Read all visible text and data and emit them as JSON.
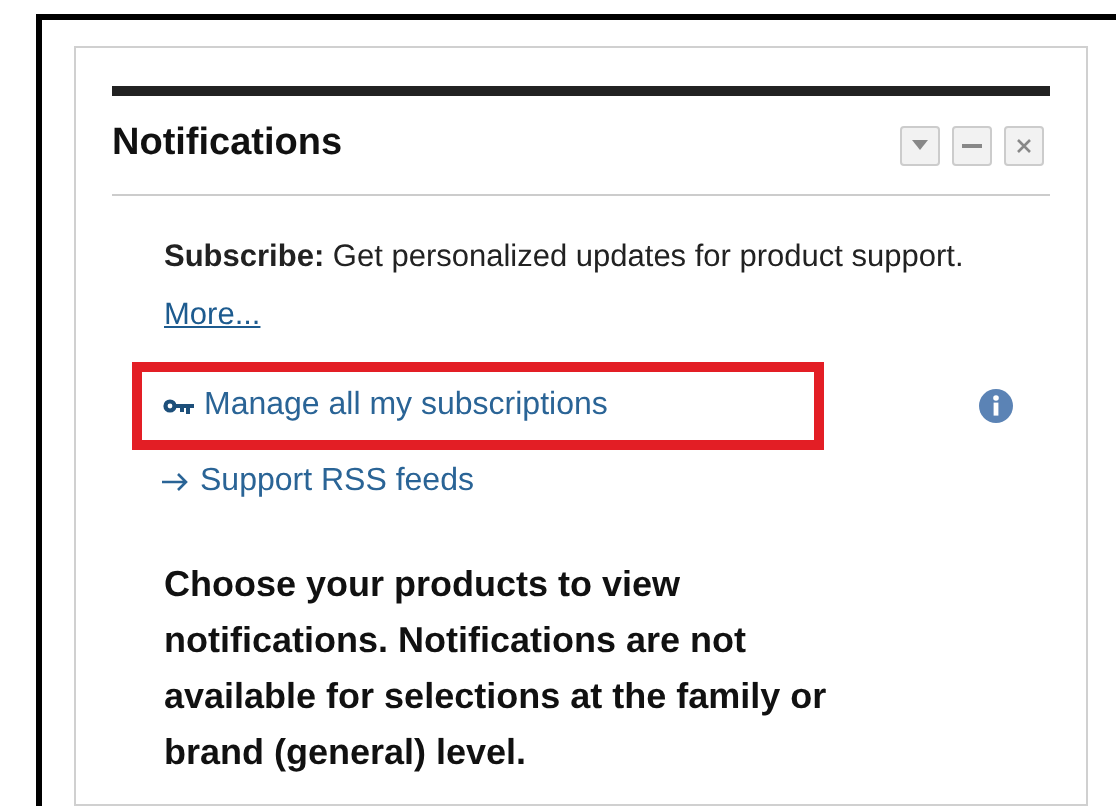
{
  "panel": {
    "title": "Notifications",
    "controls": [
      {
        "kind": "dropdown"
      },
      {
        "kind": "minimize"
      },
      {
        "kind": "close"
      }
    ]
  },
  "intro": {
    "text": "**Subscribe:** Get personalized updates for product support.",
    "link": "More..."
  },
  "links": [
    {
      "kind": "key",
      "label": "Manage all my subscriptions",
      "highlighted": true,
      "info": true
    },
    {
      "kind": "arrow",
      "label": "Support RSS feeds",
      "highlighted": false,
      "info": false
    }
  ],
  "notice": "Choose your products to view notifications. Notifications are not available for selections at the family or brand (general) level."
}
